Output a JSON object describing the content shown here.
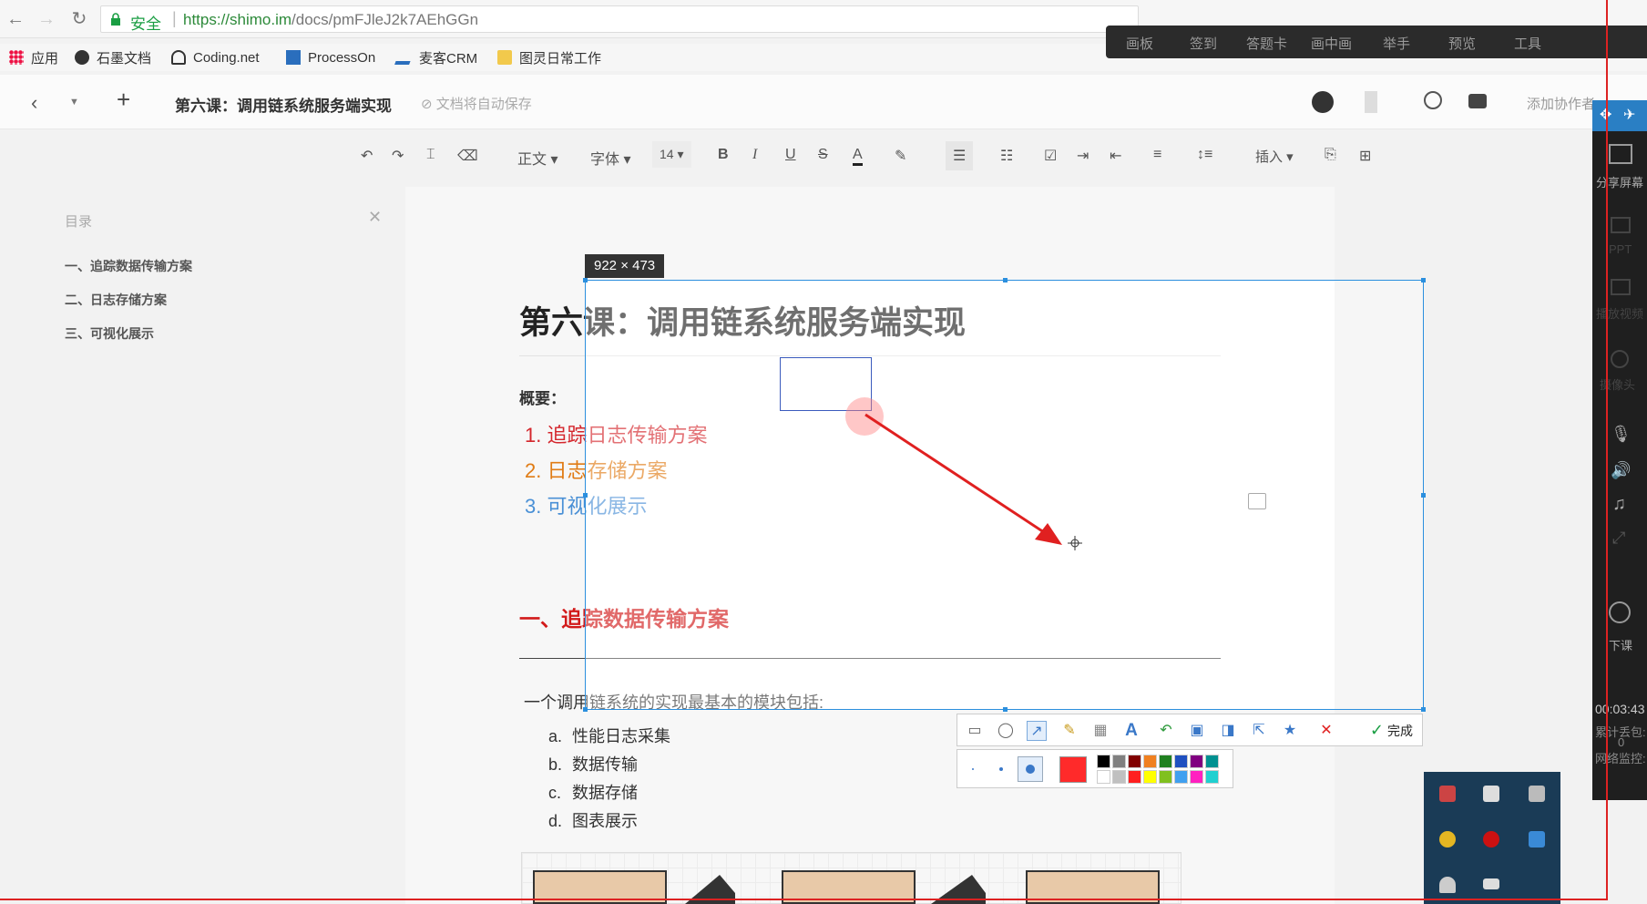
{
  "browser": {
    "secure_label": "安全",
    "url_host": "https://shimo.im",
    "url_path": "/docs/pmFJleJ2k7AEhGGn",
    "bookmarks": [
      "应用",
      "石墨文档",
      "Coding.net",
      "ProcessOn",
      "麦客CRM",
      "图灵日常工作"
    ]
  },
  "class_toolbar": [
    "画板",
    "签到",
    "答题卡",
    "画中画",
    "举手",
    "预览",
    "工具"
  ],
  "doc_header": {
    "title": "第六课：调用链系统服务端实现",
    "autosave": "文档将自动保存",
    "add_collaborator": "添加协作者"
  },
  "format_toolbar": {
    "style": "正文",
    "font": "字体",
    "size": "14",
    "insert": "插入"
  },
  "toc": {
    "title": "目录",
    "items": [
      "一、追踪数据传输方案",
      "二、日志存储方案",
      "三、可视化展示"
    ]
  },
  "document": {
    "heading": "第六课：调用链系统服务端实现",
    "summary_label": "概要：",
    "summary_items": [
      {
        "num": "1.",
        "text": "追踪日志传输方案",
        "color": "#d4262c"
      },
      {
        "num": "2.",
        "text": "日志存储方案",
        "color": "#e07b14"
      },
      {
        "num": "3.",
        "text": "可视化展示",
        "color": "#4a90d6"
      }
    ],
    "section1": "一、追踪数据传输方案",
    "paragraph": "一个调用链系统的实现最基本的模块包括:",
    "list": [
      {
        "marker": "a.",
        "text": "性能日志采集"
      },
      {
        "marker": "b.",
        "text": "数据传输"
      },
      {
        "marker": "c.",
        "text": "数据存储"
      },
      {
        "marker": "d.",
        "text": "图表展示"
      }
    ]
  },
  "capture": {
    "size_label": "922 × 473",
    "done_label": "完成",
    "tool_icons": [
      "rect-tool-icon",
      "ellipse-tool-icon",
      "arrow-tool-icon",
      "pen-tool-icon",
      "mosaic-tool-icon",
      "text-tool-icon",
      "undo-icon",
      "save-icon",
      "pin-icon",
      "share-icon",
      "star-icon",
      "cancel-icon"
    ],
    "selected_color": "#ff2a2a",
    "colors": [
      "#000000",
      "#808080",
      "#800000",
      "#f08020",
      "#208020",
      "#2050c0",
      "#800080",
      "#009090",
      "#ffffff",
      "#c0c0c0",
      "#ff2020",
      "#ffff00",
      "#80c020",
      "#40a0f0",
      "#ff20c0",
      "#20d0d0"
    ]
  },
  "side_panel": {
    "share_label": "分享屏幕",
    "ppt_label": "PPT",
    "video_label": "播放视频",
    "camera_label": "摄像头",
    "end_label": "下课",
    "timer": "00:03:43",
    "lost_label": "累计丢包:",
    "lost_value": "0",
    "net_label": "网络监控:"
  }
}
